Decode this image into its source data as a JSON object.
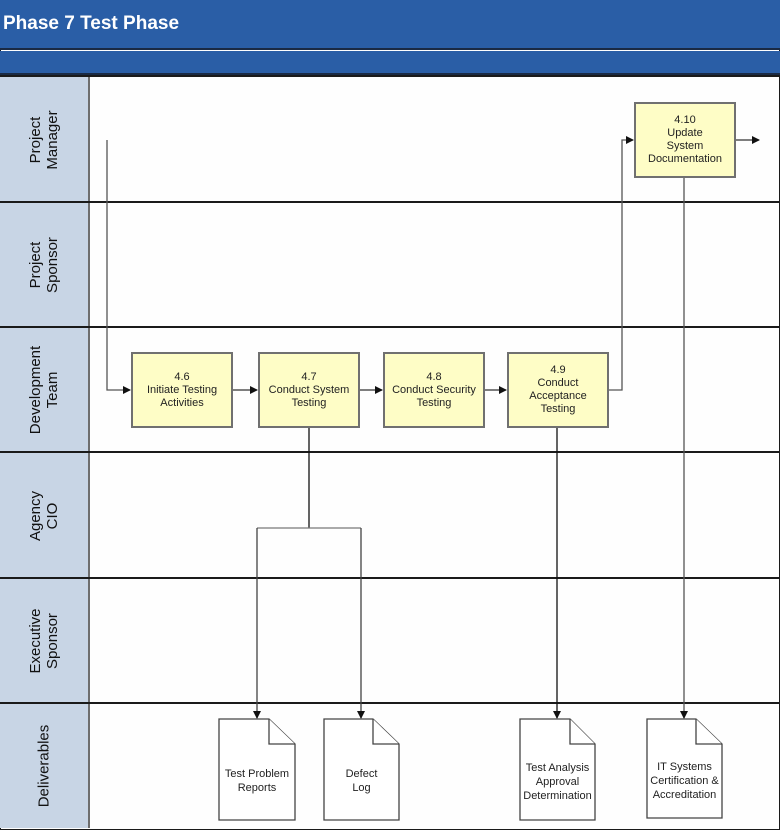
{
  "title": "Phase 7 Test Phase",
  "lanes": [
    {
      "label": "Project\nManager"
    },
    {
      "label": "Project\nSponsor"
    },
    {
      "label": "Development\nTeam"
    },
    {
      "label": "Agency\nCIO"
    },
    {
      "label": "Executive\nSponsor"
    },
    {
      "label": "Deliverables"
    }
  ],
  "activities": [
    {
      "id": "4.6",
      "label": "Initiate Testing\nActivities",
      "lane": "Development Team"
    },
    {
      "id": "4.7",
      "label": "Conduct System\nTesting",
      "lane": "Development Team"
    },
    {
      "id": "4.8",
      "label": "Conduct Security\nTesting",
      "lane": "Development Team"
    },
    {
      "id": "4.9",
      "label": "Conduct\nAcceptance\nTesting",
      "lane": "Development Team"
    },
    {
      "id": "4.10",
      "label": "Update\nSystem\nDocumentation",
      "lane": "Project Manager"
    }
  ],
  "deliverables": [
    {
      "label": "Test Problem\nReports"
    },
    {
      "label": "Defect\nLog"
    },
    {
      "label": "Test Analysis\nApproval\nDetermination"
    },
    {
      "label": "IT Systems\nCertification &\nAccreditation"
    }
  ],
  "flows": [
    {
      "from": "start",
      "to": "4.6"
    },
    {
      "from": "4.6",
      "to": "4.7"
    },
    {
      "from": "4.7",
      "to": "4.8"
    },
    {
      "from": "4.8",
      "to": "4.9"
    },
    {
      "from": "4.9",
      "to": "4.10"
    },
    {
      "from": "4.10",
      "to": "end"
    },
    {
      "from": "4.7",
      "to": "Test Problem Reports"
    },
    {
      "from": "4.7",
      "to": "Defect Log"
    },
    {
      "from": "4.9",
      "to": "Test Analysis Approval Determination"
    },
    {
      "from": "4.10",
      "to": "IT Systems Certification & Accreditation"
    }
  ],
  "colors": {
    "header": "#2a5ea6",
    "lane_label_bg": "#c8d5e5",
    "activity_fill": "#fefdc6"
  }
}
